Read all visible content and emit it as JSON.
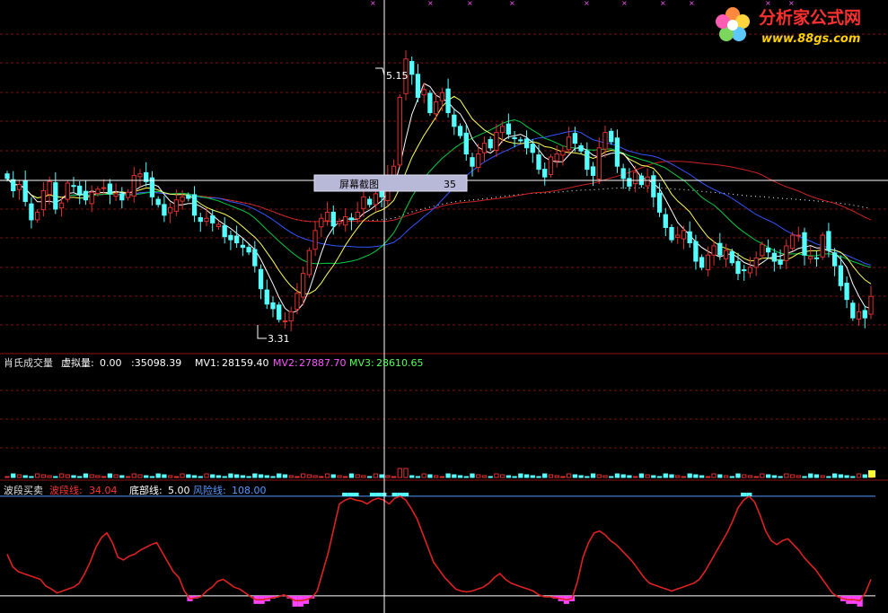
{
  "logo": {
    "brand": "分析家公式网",
    "url": "www.88gs.com"
  },
  "colors": {
    "background": "#000000",
    "grid": "#7a1010",
    "up": "#e03030",
    "down": "#55ffff",
    "crosshair": "#ffffff",
    "ma5": "#ffffff",
    "ma10": "#ffff55",
    "ma20": "#00cc44",
    "ma30": "#3355ff",
    "ma60": "#cc2222",
    "ma120": "#ffffff",
    "mv1": "#ffffff",
    "mv2": "#ff55ff",
    "mv3": "#55ff55",
    "wave": "#dd2222",
    "risk_line": "#5599ff",
    "bottom_line": "#ffffff",
    "histogram": "#ff44ff",
    "cap": "#55ffff"
  },
  "price_panel": {
    "high_label": "5.15",
    "low_label": "3.31",
    "tooltip_text": "屏幕截图",
    "tooltip_value": "35"
  },
  "volume_panel": {
    "name": "肖氏成交量",
    "virtual_label": "虚拟量:",
    "virtual_value": "0.00",
    "value": ":35098.39",
    "mv1_label": "MV1:",
    "mv1_value": "28159.40",
    "mv2_label": "MV2:",
    "mv2_value": "27887.70",
    "mv3_label": "MV3:",
    "mv3_value": "28610.65"
  },
  "indicator_panel": {
    "name": "波段买卖",
    "wave_label": "波段线:",
    "wave_value": "34.04",
    "bottom_label": "底部线:",
    "bottom_value": "5.00",
    "risk_label": "风险线:",
    "risk_value": "108.00"
  },
  "chart_data": [
    {
      "type": "candlestick",
      "title": "",
      "ylim": [
        3.2,
        5.45
      ],
      "annotations": [
        {
          "label": "5.15",
          "value": 5.15,
          "kind": "high"
        },
        {
          "label": "3.31",
          "value": 3.31,
          "kind": "low"
        }
      ],
      "series": [
        {
          "kind": "close",
          "values": [
            4.32,
            4.24,
            4.28,
            4.17,
            4.05,
            4.1,
            4.24,
            4.3,
            4.12,
            4.16,
            4.29,
            4.27,
            4.22,
            4.18,
            4.23,
            4.25,
            4.26,
            4.22,
            4.22,
            4.18,
            4.23,
            4.34,
            4.35,
            4.3,
            4.2,
            4.15,
            4.08,
            4.13,
            4.18,
            4.2,
            4.19,
            4.08,
            4.04,
            4.06,
            4.03,
            4.02,
            3.94,
            3.92,
            3.9,
            3.87,
            3.84,
            3.75,
            3.6,
            3.5,
            3.47,
            3.4,
            3.39,
            3.45,
            3.57,
            3.7,
            3.85,
            3.98,
            4.06,
            4.1,
            4.01,
            4.04,
            4.07,
            4.05,
            4.1,
            4.2,
            4.15,
            4.22,
            4.2,
            4.34,
            4.4,
            4.85,
            5.1,
            5.0,
            4.85,
            4.9,
            4.75,
            4.82,
            4.88,
            4.75,
            4.66,
            4.6,
            4.48,
            4.4,
            4.48,
            4.55,
            4.52,
            4.62,
            4.66,
            4.61,
            4.58,
            4.57,
            4.52,
            4.49,
            4.38,
            4.33,
            4.46,
            4.48,
            4.5,
            4.59,
            4.55,
            4.5,
            4.38,
            4.34,
            4.52,
            4.62,
            4.56,
            4.4,
            4.32,
            4.27,
            4.36,
            4.28,
            4.33,
            4.2,
            4.1,
            4.0,
            3.92,
            3.95,
            3.98,
            3.9,
            3.78,
            3.74,
            3.82,
            3.88,
            3.82,
            3.85,
            3.77,
            3.7,
            3.72,
            3.74,
            3.8,
            3.89,
            3.84,
            3.78,
            3.76,
            3.88,
            3.95,
            3.95,
            3.82,
            3.81,
            3.8,
            3.95,
            3.85,
            3.75,
            3.62,
            3.53,
            3.41,
            3.45,
            3.41,
            3.55
          ]
        },
        {
          "name": "MA5"
        },
        {
          "name": "MA10"
        },
        {
          "name": "MA20"
        },
        {
          "name": "MA30"
        },
        {
          "name": "MA60"
        },
        {
          "name": "MA120"
        }
      ]
    },
    {
      "type": "bar",
      "title": "肖氏成交量",
      "series": [
        {
          "name": "虚拟量",
          "values": [
            0.0
          ]
        }
      ],
      "values_printed": {
        "value": 35098.39,
        "MV1": 28159.4,
        "MV2": 27887.7,
        "MV3": 28610.65
      }
    },
    {
      "type": "line",
      "title": "波段买卖",
      "ylim": [
        -10,
        120
      ],
      "series": [
        {
          "name": "波段线",
          "values": [
            48,
            35,
            30,
            28,
            26,
            24,
            22,
            15,
            12,
            8,
            10,
            12,
            14,
            18,
            28,
            40,
            55,
            65,
            70,
            60,
            45,
            42,
            46,
            48,
            52,
            55,
            58,
            60,
            50,
            40,
            30,
            24,
            10,
            2,
            3,
            4,
            10,
            14,
            20,
            22,
            18,
            14,
            12,
            8,
            4,
            1,
            1,
            2,
            3,
            4,
            6,
            3,
            0,
            0,
            1,
            3,
            10,
            30,
            50,
            75,
            100,
            104,
            106,
            104,
            103,
            100,
            104,
            106,
            104,
            100,
            106,
            108,
            104,
            95,
            85,
            70,
            55,
            40,
            32,
            24,
            18,
            12,
            10,
            9,
            10,
            12,
            14,
            18,
            24,
            28,
            22,
            18,
            16,
            14,
            12,
            10,
            6,
            4,
            4,
            3,
            2,
            1,
            2,
            20,
            45,
            60,
            70,
            72,
            68,
            62,
            58,
            52,
            46,
            40,
            32,
            24,
            18,
            16,
            14,
            12,
            10,
            12,
            14,
            16,
            18,
            22,
            30,
            40,
            50,
            60,
            70,
            82,
            96,
            104,
            108,
            102,
            88,
            72,
            62,
            58,
            62,
            64,
            58,
            52,
            44,
            38,
            32,
            24,
            16,
            8,
            4,
            2,
            1,
            1,
            0,
            8,
            22
          ]
        },
        {
          "name": "底部线",
          "values": [
            5.0
          ]
        },
        {
          "name": "风险线",
          "values": [
            108.0
          ]
        }
      ]
    }
  ]
}
